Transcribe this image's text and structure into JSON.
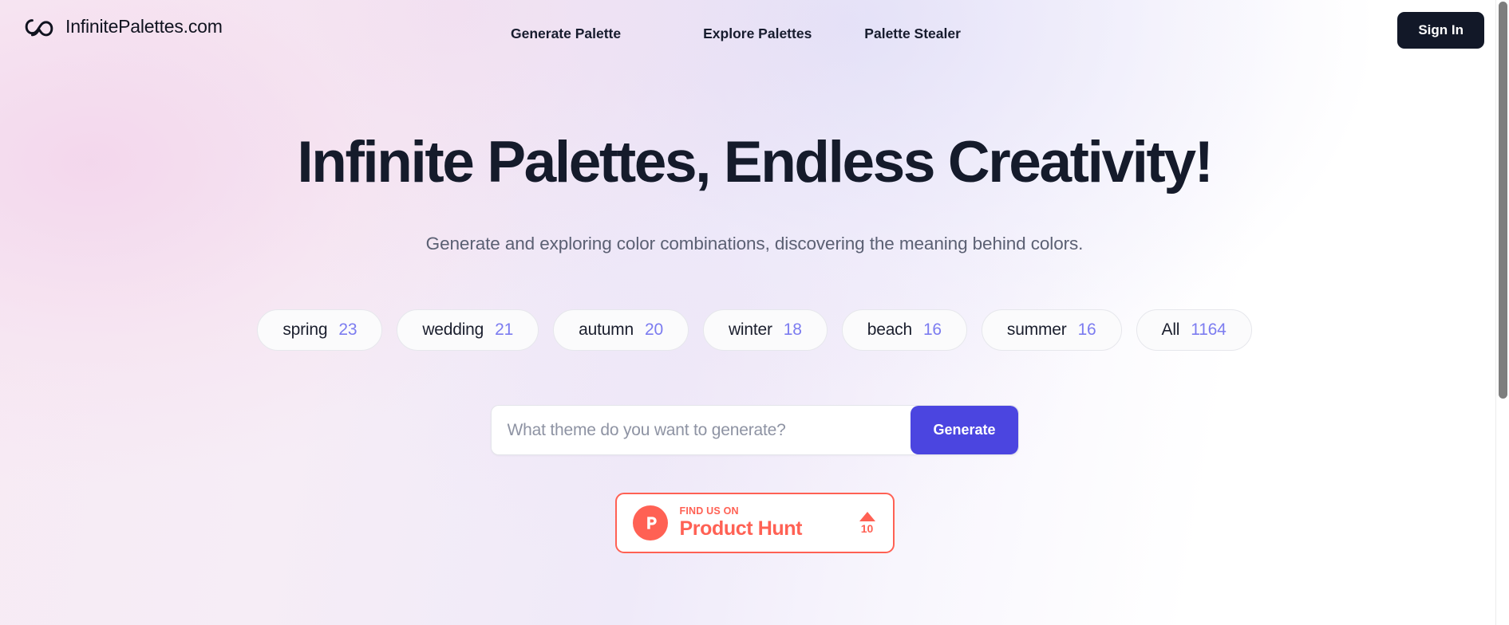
{
  "brand": {
    "logo_icon": "infinity-icon",
    "name": "InfinitePalettes.com"
  },
  "nav": {
    "items": [
      {
        "label": "Generate Palette"
      },
      {
        "label": "Explore Palettes"
      },
      {
        "label": "Palette Stealer"
      }
    ],
    "signin_label": "Sign In"
  },
  "hero": {
    "title": "Infinite Palettes, Endless Creativity!",
    "subtitle": "Generate and exploring color combinations, discovering the meaning behind colors."
  },
  "tags": [
    {
      "label": "spring",
      "count": "23"
    },
    {
      "label": "wedding",
      "count": "21"
    },
    {
      "label": "autumn",
      "count": "20"
    },
    {
      "label": "winter",
      "count": "18"
    },
    {
      "label": "beach",
      "count": "16"
    },
    {
      "label": "summer",
      "count": "16"
    },
    {
      "label": "All",
      "count": "1164"
    }
  ],
  "search": {
    "placeholder": "What theme do you want to generate?",
    "value": "",
    "generate_label": "Generate"
  },
  "product_hunt": {
    "logo_icon": "product-hunt-p-icon",
    "kicker": "FIND US ON",
    "name": "Product Hunt",
    "upvote_icon": "caret-up-icon",
    "upvote_count": "10"
  },
  "colors": {
    "accent_indigo": "#4b45e0",
    "count_purple": "#7c7cf0",
    "ink": "#151b2b",
    "signin_bg": "#121828",
    "product_hunt": "#ff6154",
    "muted_text": "#5b6073",
    "placeholder": "#8e93a3"
  }
}
